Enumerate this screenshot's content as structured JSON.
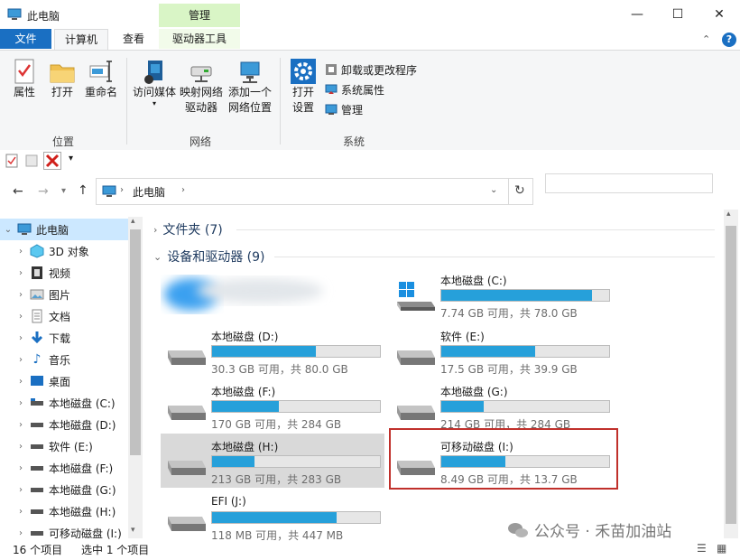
{
  "window": {
    "title": "此电脑"
  },
  "ribbon_tabs": {
    "file": "文件",
    "computer": "计算机",
    "view": "查看",
    "context_header": "管理",
    "drive_tools": "驱动器工具"
  },
  "ribbon": {
    "location_group": {
      "label": "位置",
      "properties": "属性",
      "open": "打开",
      "rename": "重命名"
    },
    "network_group": {
      "label": "网络",
      "access_media_1": "访问媒体",
      "map_drive_1": "映射网络",
      "map_drive_2": "驱动器",
      "add_location_1": "添加一个",
      "add_location_2": "网络位置"
    },
    "system_group": {
      "label": "系统",
      "open_settings_1": "打开",
      "open_settings_2": "设置",
      "uninstall": "卸载或更改程序",
      "system_properties": "系统属性",
      "manage": "管理"
    }
  },
  "address": {
    "path": "此电脑",
    "search_placeholder": ""
  },
  "nav": {
    "items": [
      {
        "label": "此电脑"
      },
      {
        "label": "3D 对象"
      },
      {
        "label": "视频"
      },
      {
        "label": "图片"
      },
      {
        "label": "文档"
      },
      {
        "label": "下载"
      },
      {
        "label": "音乐"
      },
      {
        "label": "桌面"
      },
      {
        "label": "本地磁盘 (C:)"
      },
      {
        "label": "本地磁盘 (D:)"
      },
      {
        "label": "软件 (E:)"
      },
      {
        "label": "本地磁盘 (F:)"
      },
      {
        "label": "本地磁盘 (G:)"
      },
      {
        "label": "本地磁盘 (H:)"
      },
      {
        "label": "可移动磁盘 (I:)"
      }
    ]
  },
  "sections": {
    "folders": "文件夹 (7)",
    "devices": "设备和驱动器 (9)"
  },
  "drives": [
    {
      "name": "本地磁盘 (C:)",
      "info": "7.74 GB 可用，共 78.0 GB",
      "used_fraction": 0.9
    },
    {
      "name": "本地磁盘 (D:)",
      "info": "30.3 GB 可用，共 80.0 GB",
      "used_fraction": 0.62
    },
    {
      "name": "软件 (E:)",
      "info": "17.5 GB 可用，共 39.9 GB",
      "used_fraction": 0.56
    },
    {
      "name": "本地磁盘 (F:)",
      "info": "170 GB 可用，共 284 GB",
      "used_fraction": 0.4
    },
    {
      "name": "本地磁盘 (G:)",
      "info": "214 GB 可用，共 284 GB",
      "used_fraction": 0.25
    },
    {
      "name": "本地磁盘 (H:)",
      "info": "213 GB 可用，共 283 GB",
      "used_fraction": 0.25
    },
    {
      "name": "可移动磁盘 (I:)",
      "info": "8.49 GB 可用，共 13.7 GB",
      "used_fraction": 0.38
    },
    {
      "name": "EFI (J:)",
      "info": "118 MB 可用，共 447 MB",
      "used_fraction": 0.74
    }
  ],
  "status": {
    "count": "16 个项目",
    "selected": "选中 1 个项目"
  },
  "watermark": {
    "text": "公众号 · 禾苗加油站"
  },
  "colors": {
    "accent": "#1a6fc2",
    "bar_fill": "#26a0da",
    "highlight_box": "#c0302b",
    "context_tab": "#d9f5c6"
  }
}
